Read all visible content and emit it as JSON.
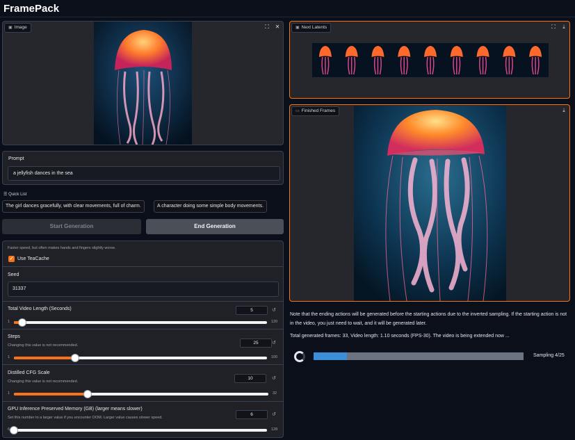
{
  "app": {
    "title": "FramePack"
  },
  "image_panel": {
    "label": "Image",
    "icon": "image-icon"
  },
  "prompt": {
    "label": "Prompt",
    "value": "a jellyfish dances in the sea"
  },
  "quick_list": {
    "label": "Quick List",
    "items": [
      "The girl dances gracefully, with clear movements, full of charm.",
      "A character doing some simple body movements."
    ]
  },
  "buttons": {
    "start": "Start Generation",
    "end": "End Generation"
  },
  "teacache": {
    "hint": "Faster speed, but often makes hands and fingers slightly worse.",
    "label": "Use TeaCache",
    "checked": true
  },
  "seed": {
    "label": "Seed",
    "value": "31337"
  },
  "video_length": {
    "label": "Total Video Length (Seconds)",
    "value": "5",
    "min": "1",
    "max": "120",
    "fraction": 0.034
  },
  "steps": {
    "label": "Steps",
    "hint": "Changing this value is not recommended.",
    "value": "25",
    "min": "1",
    "max": "100",
    "fraction": 0.242
  },
  "cfg": {
    "label": "Distilled CFG Scale",
    "hint": "Changing this value is not recommended.",
    "value": "10",
    "min": "1",
    "max": "32",
    "fraction": 0.29
  },
  "gpu_memory": {
    "label": "GPU Inference Preserved Memory (GB) (larger means slower)",
    "hint": "Set this number to a larger value if you encounter OOM. Larger value causes slower speed.",
    "value": "6",
    "min": "6",
    "max": "128",
    "fraction": 0.0
  },
  "latents_panel": {
    "label": "Next Latents",
    "frame_count": 9
  },
  "frames_panel": {
    "label": "Finished Frames"
  },
  "status": {
    "note": "Note that the ending actions will be generated before the starting actions due to the inverted sampling. If the starting action is not in the video, you just need to wait, and it will be generated later.",
    "total": "Total generated frames: 33, Video length: 1.10 seconds (FPS-30). The video is being extended now ...",
    "progress_fraction": 0.16,
    "progress_label": "Sampling 4/25"
  },
  "colors": {
    "accent": "#f97316",
    "progress": "#3b8ed8",
    "background": "#0b0f19",
    "panel": "#1f2126"
  }
}
